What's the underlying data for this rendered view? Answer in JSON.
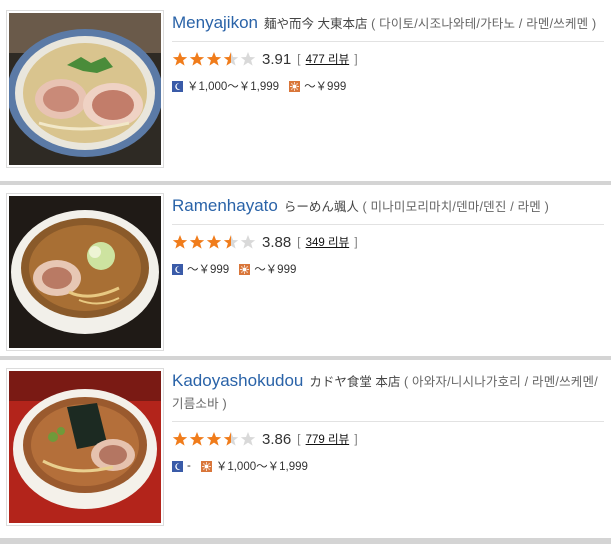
{
  "restaurants": [
    {
      "name": "Menyajikon",
      "native": "麺や而今 大東本店",
      "area": "( 다이토/시조나와테/가타노 / 라멘/쓰케멘 )",
      "score": "3.91",
      "rating_value": 3.5,
      "review_open": "[",
      "review_count": "477 리뷰",
      "review_close": "]",
      "dinner_price": "￥1,000～￥1,999",
      "lunch_price": "～￥999",
      "thumb_bg": "#2e2a24"
    },
    {
      "name": "Ramenhayato",
      "native": "らーめん颯人",
      "area": "( 미나미모리마치/덴마/덴진 / 라멘 )",
      "score": "3.88",
      "rating_value": 3.5,
      "review_open": "[",
      "review_count": "349 리뷰",
      "review_close": "]",
      "dinner_price": "～￥999",
      "lunch_price": "～￥999",
      "thumb_bg": "#1f1a16"
    },
    {
      "name": "Kadoyashokudou",
      "native": "カドヤ食堂 本店",
      "area": "( 아와자/니시나가호리 / 라멘/쓰케멘/기름소바 )",
      "score": "3.86",
      "rating_value": 3.5,
      "review_open": "[",
      "review_count": "779 리뷰",
      "review_close": "]",
      "dinner_price": "-",
      "lunch_price": "￥1,000～￥1,999",
      "thumb_bg": "#b3241b"
    }
  ],
  "colors": {
    "star": "#f07c1b",
    "star_empty": "#d9d9d9",
    "name_link": "#2a63a8",
    "dinner_icon": "#3a5ba8",
    "lunch_icon": "#d9763a"
  },
  "icons": {
    "dinner": "moon-icon",
    "lunch": "sun-icon"
  }
}
